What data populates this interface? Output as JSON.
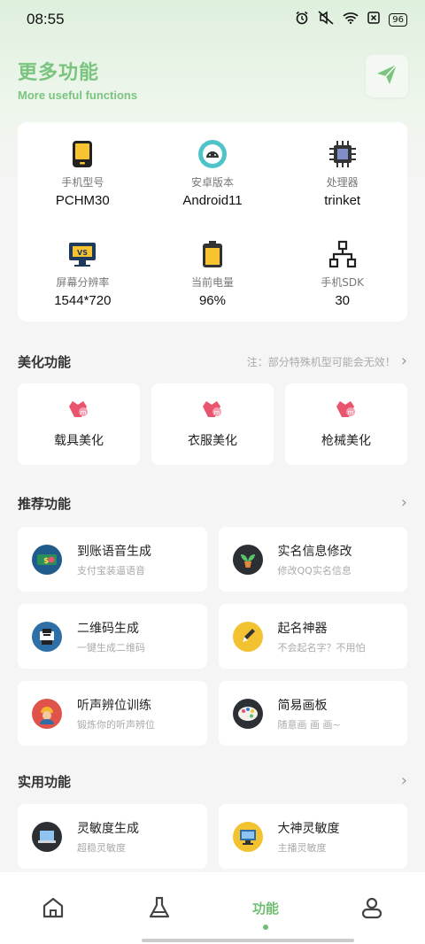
{
  "status": {
    "time": "08:55",
    "battery": "96"
  },
  "header": {
    "title": "更多功能",
    "subtitle": "More useful functions"
  },
  "device_info": [
    {
      "label": "手机型号",
      "value": "PCHM30",
      "icon": "phone-icon"
    },
    {
      "label": "安卓版本",
      "value": "Android11",
      "icon": "android-icon"
    },
    {
      "label": "处理器",
      "value": "trinket",
      "icon": "cpu-icon"
    },
    {
      "label": "屏幕分辨率",
      "value": "1544*720",
      "icon": "monitor-icon"
    },
    {
      "label": "当前电量",
      "value": "96%",
      "icon": "battery-icon"
    },
    {
      "label": "手机SDK",
      "value": "30",
      "icon": "network-icon"
    }
  ],
  "beauty": {
    "title": "美化功能",
    "note": "注：部分特殊机型可能会无效！",
    "items": [
      {
        "label": "载具美化"
      },
      {
        "label": "衣服美化"
      },
      {
        "label": "枪械美化"
      }
    ]
  },
  "recommend": {
    "title": "推荐功能",
    "items": [
      {
        "title": "到账语音生成",
        "sub": "支付宝装逼语音",
        "icon": "money-icon"
      },
      {
        "title": "实名信息修改",
        "sub": "修改QQ实名信息",
        "icon": "plant-icon"
      },
      {
        "title": "二维码生成",
        "sub": "一键生成二维码",
        "icon": "qrcode-icon"
      },
      {
        "title": "起名神器",
        "sub": "不会起名字？不用怕",
        "icon": "pen-icon"
      },
      {
        "title": "听声辨位训练",
        "sub": "锻炼你的听声辨位",
        "icon": "worker-icon"
      },
      {
        "title": "简易画板",
        "sub": "随意画 画 画~",
        "icon": "palette-icon"
      }
    ]
  },
  "practical": {
    "title": "实用功能",
    "items": [
      {
        "title": "灵敏度生成",
        "sub": "超稳灵敏度",
        "icon": "laptop-icon"
      },
      {
        "title": "大神灵敏度",
        "sub": "主播灵敏度",
        "icon": "computer-icon"
      }
    ]
  },
  "tabs": [
    {
      "label": "",
      "icon": "home-icon"
    },
    {
      "label": "",
      "icon": "flask-icon"
    },
    {
      "label": "功能",
      "active": true
    },
    {
      "label": "",
      "icon": "user-icon"
    }
  ],
  "colors": {
    "accent": "#7ac47f",
    "background": "#f5f5f5",
    "card": "#ffffff"
  }
}
